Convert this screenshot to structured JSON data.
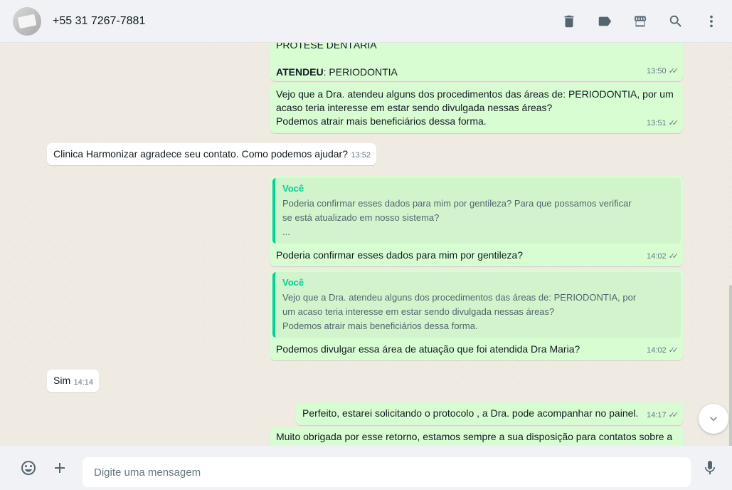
{
  "header": {
    "contact_name": "+55 31 7267-7881",
    "icons": [
      "delete-icon",
      "label-icon",
      "shop-icon",
      "search-icon",
      "menu-icon"
    ]
  },
  "messages": [
    {
      "direction": "out",
      "lines": [
        "PRÓTESE DENTÁRIA",
        ""
      ],
      "label": "ATENDEU",
      "label_value": ": PERIODONTIA",
      "time": "13:50"
    },
    {
      "direction": "out",
      "lines": [
        "Vejo que a Dra. atendeu alguns dos procedimentos das áreas de: PERIODONTIA, por um",
        "acaso teria interesse em estar sendo divulgada nessas áreas?",
        "Podemos atrair mais beneficiários dessa forma."
      ],
      "time": "13:51"
    },
    {
      "direction": "in",
      "text": "Clinica Harmonizar agradece seu contato. Como podemos ajudar?",
      "time": "13:52"
    },
    {
      "direction": "out",
      "quote_author": "Você",
      "quote_lines": [
        "Poderia confirmar esses dados para mim por gentileza? Para que possamos verificar",
        "se está atualizado em nosso sistema?",
        "..."
      ],
      "text": "Poderia confirmar esses dados para mim por gentileza?",
      "time": "14:02"
    },
    {
      "direction": "out",
      "quote_author": "Você",
      "quote_lines": [
        "Vejo que a Dra. atendeu alguns dos procedimentos das áreas de: PERIODONTIA, por",
        "um acaso teria interesse em estar sendo divulgada nessas áreas?",
        "Podemos atrair mais beneficiários dessa forma."
      ],
      "text": "Podemos divulgar essa área de atuação que foi atendida Dra Maria?",
      "time": "14:02"
    },
    {
      "direction": "in",
      "text": "Sim",
      "time": "14:14"
    },
    {
      "direction": "out",
      "text": "Perfeito, estarei solicitando o protocolo , a Dra. pode acompanhar no painel.",
      "time": "14:17"
    },
    {
      "direction": "out",
      "text": "Muito obrigada por esse retorno, estamos sempre a sua disposição para contatos sobre a"
    }
  ],
  "composer": {
    "placeholder": "Digite uma mensagem"
  },
  "colors": {
    "outgoing_bubble": "#d9fdd3",
    "incoming_bubble": "#ffffff",
    "quote_accent": "#06cf9c",
    "background": "#efeae2"
  }
}
